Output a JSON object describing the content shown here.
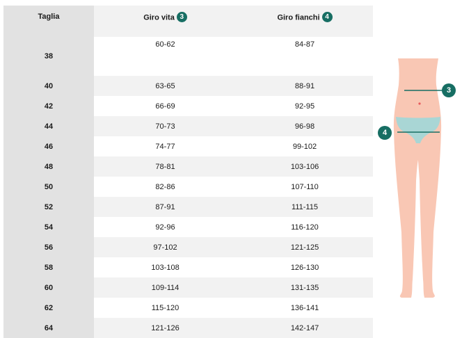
{
  "table": {
    "headers": {
      "size": "Taglia",
      "waist": "Giro vita",
      "waist_badge": "3",
      "hips": "Giro fianchi",
      "hips_badge": "4"
    },
    "rows": [
      {
        "size": "38",
        "waist": "60-62",
        "hips": "84-87"
      },
      {
        "size": "40",
        "waist": "63-65",
        "hips": "88-91"
      },
      {
        "size": "42",
        "waist": "66-69",
        "hips": "92-95"
      },
      {
        "size": "44",
        "waist": "70-73",
        "hips": "96-98"
      },
      {
        "size": "46",
        "waist": "74-77",
        "hips": "99-102"
      },
      {
        "size": "48",
        "waist": "78-81",
        "hips": "103-106"
      },
      {
        "size": "50",
        "waist": "82-86",
        "hips": "107-110"
      },
      {
        "size": "52",
        "waist": "87-91",
        "hips": "111-115"
      },
      {
        "size": "54",
        "waist": "92-96",
        "hips": "116-120"
      },
      {
        "size": "56",
        "waist": "97-102",
        "hips": "121-125"
      },
      {
        "size": "58",
        "waist": "103-108",
        "hips": "126-130"
      },
      {
        "size": "60",
        "waist": "109-114",
        "hips": "131-135"
      },
      {
        "size": "62",
        "waist": "115-120",
        "hips": "136-141"
      },
      {
        "size": "64",
        "waist": "121-126",
        "hips": "142-147"
      }
    ]
  },
  "figure": {
    "waist_marker": "3",
    "hip_marker": "4",
    "colors": {
      "skin": "#f9c7b4",
      "underwear": "#a9d6d5",
      "accent": "#176e63"
    }
  }
}
